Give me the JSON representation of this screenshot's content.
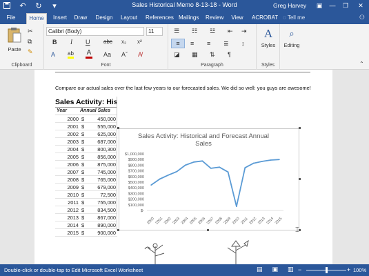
{
  "window": {
    "title": "Sales Historical Memo 8-13-18  -  Word",
    "user": "Greg Harvey",
    "minimize": "—",
    "restore": "❐",
    "close": "✕",
    "ribbon_display": "▣"
  },
  "tabs": [
    "File",
    "Home",
    "Insert",
    "Draw",
    "Design",
    "Layout",
    "References",
    "Mailings",
    "Review",
    "View",
    "ACROBAT"
  ],
  "tellme": "Tell me",
  "ribbon": {
    "clipboard": {
      "label": "Clipboard",
      "paste": "Paste"
    },
    "font": {
      "label": "Font",
      "name": "Calibri (Body)",
      "size": "11"
    },
    "paragraph": {
      "label": "Paragraph"
    },
    "styles": {
      "label": "Styles",
      "button": "Styles"
    },
    "editing": {
      "button": "Editing"
    }
  },
  "document": {
    "paragraph": "Compare our actual sales over the last few years to our forecasted sales. We did so well: you guys are awesome!",
    "table": {
      "title": "Sales Activity: Historical",
      "headers": [
        "Year",
        "Annual Sales"
      ],
      "currency": "$",
      "rows": [
        [
          "2000",
          "450,000"
        ],
        [
          "2001",
          "555,000"
        ],
        [
          "2002",
          "625,000"
        ],
        [
          "2003",
          "687,000"
        ],
        [
          "2004",
          "800,300"
        ],
        [
          "2005",
          "856,000"
        ],
        [
          "2006",
          "875,000"
        ],
        [
          "2007",
          "745,000"
        ],
        [
          "2008",
          "765,000"
        ],
        [
          "2009",
          "679,000"
        ],
        [
          "2010",
          "72,500"
        ],
        [
          "2011",
          "755,000"
        ],
        [
          "2012",
          "834,500"
        ],
        [
          "2013",
          "867,000"
        ],
        [
          "2014",
          "890,000"
        ],
        [
          "2015",
          "900,000"
        ]
      ]
    }
  },
  "chart_data": {
    "type": "line",
    "title": "Sales Activity: Historical and Forecast Annual Sales",
    "title_lines": [
      "Sales Activity: Historical and Forecast Annual",
      "Sales"
    ],
    "xlabel": "",
    "ylabel": "",
    "categories": [
      "2000",
      "2001",
      "2002",
      "2003",
      "2004",
      "2005",
      "2006",
      "2007",
      "2008",
      "2009",
      "2010",
      "2011",
      "2012",
      "2013",
      "2014",
      "2015"
    ],
    "values": [
      450000,
      555000,
      625000,
      687000,
      800300,
      856000,
      875000,
      745000,
      765000,
      679000,
      72500,
      755000,
      834500,
      867000,
      890000,
      900000
    ],
    "ylim": [
      0,
      1000000
    ],
    "yticks": [
      "$-",
      "$100,000",
      "$200,000",
      "$300,000",
      "$400,000",
      "$500,000",
      "$600,000",
      "$700,000",
      "$800,000",
      "$900,000",
      "$1,000,000"
    ],
    "grid": false,
    "color": "#5b9bd5"
  },
  "status": {
    "message": "Double-click or double-tap to Edit Microsoft Excel Worksheet",
    "zoom": "100%",
    "zoom_fraction": 0.5
  },
  "colors": {
    "accent": "#2b579a",
    "chart_line": "#5b9bd5",
    "font_color": "#c00000",
    "highlight": "#ffff00"
  }
}
